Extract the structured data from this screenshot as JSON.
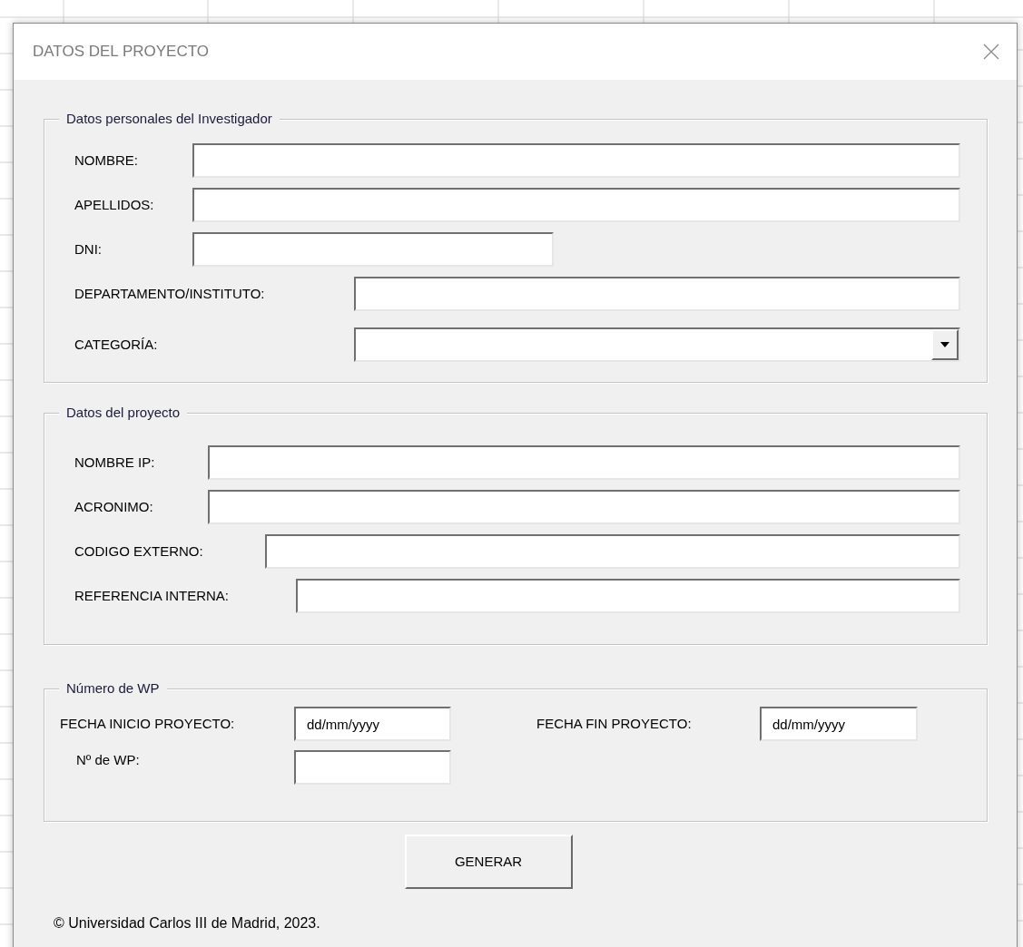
{
  "window": {
    "title": "DATOS DEL PROYECTO"
  },
  "sections": [
    {
      "legend": "Datos personales del Investigador",
      "fields": [
        {
          "label": "NOMBRE:",
          "kind": "text"
        },
        {
          "label": "APELLIDOS:",
          "kind": "text"
        },
        {
          "label": "DNI:",
          "kind": "text"
        },
        {
          "label": "DEPARTAMENTO/INSTITUTO:",
          "kind": "text"
        },
        {
          "label": "CATEGORÍA:",
          "kind": "combo"
        }
      ]
    },
    {
      "legend": "Datos del proyecto",
      "fields": [
        {
          "label": "NOMBRE IP:",
          "kind": "text"
        },
        {
          "label": "ACRONIMO:",
          "kind": "text"
        },
        {
          "label": "CODIGO EXTERNO:",
          "kind": "text"
        },
        {
          "label": "REFERENCIA INTERNA:",
          "kind": "text"
        }
      ]
    },
    {
      "legend": "Número de WP",
      "fields": [
        {
          "label": "FECHA INICIO PROYECTO:",
          "kind": "text",
          "value": "dd/mm/yyyy"
        },
        {
          "label": "FECHA FIN PROYECTO:",
          "kind": "text",
          "value": "dd/mm/yyyy"
        },
        {
          "label": "Nº de WP:",
          "kind": "text"
        }
      ]
    }
  ],
  "button": "GENERAR",
  "footer": "© Universidad Carlos III de Madrid, 2023."
}
